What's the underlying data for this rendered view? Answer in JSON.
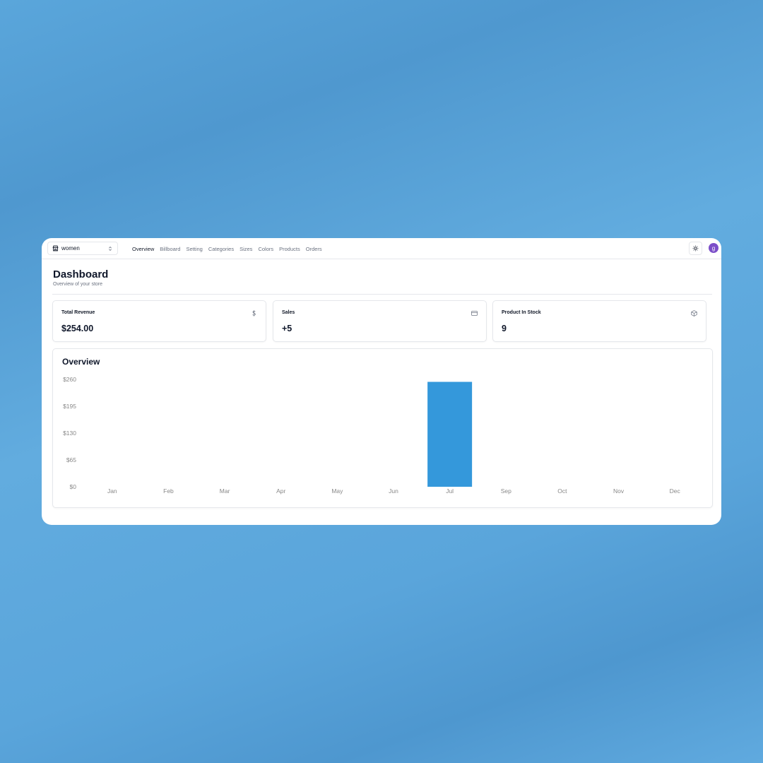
{
  "store_switcher": {
    "name": "women"
  },
  "nav": {
    "links": [
      "Overview",
      "Billboard",
      "Setting",
      "Categories",
      "Sizes",
      "Colors",
      "Products",
      "Orders"
    ],
    "active": "Overview"
  },
  "user": {
    "avatar_initial": "g"
  },
  "header": {
    "title": "Dashboard",
    "subtitle": "Overview of your store"
  },
  "stats": [
    {
      "label": "Total Revenue",
      "value": "$254.00",
      "icon": "dollar-icon"
    },
    {
      "label": "Sales",
      "value": "+5",
      "icon": "credit-card-icon"
    },
    {
      "label": "Product In Stock",
      "value": "9",
      "icon": "package-icon"
    }
  ],
  "overview": {
    "title": "Overview"
  },
  "colors": {
    "accent": "#3498db",
    "avatar": "#7c4fc9",
    "background": "#5ba7dc"
  },
  "chart_data": {
    "type": "bar",
    "categories": [
      "Jan",
      "Feb",
      "Mar",
      "Apr",
      "May",
      "Jun",
      "Jul",
      "Sep",
      "Oct",
      "Nov",
      "Dec"
    ],
    "values": [
      0,
      0,
      0,
      0,
      0,
      0,
      254,
      0,
      0,
      0,
      0
    ],
    "yticks": [
      "$0",
      "$65",
      "$130",
      "$195",
      "$260"
    ],
    "ylim": [
      0,
      260
    ],
    "grid": false
  }
}
